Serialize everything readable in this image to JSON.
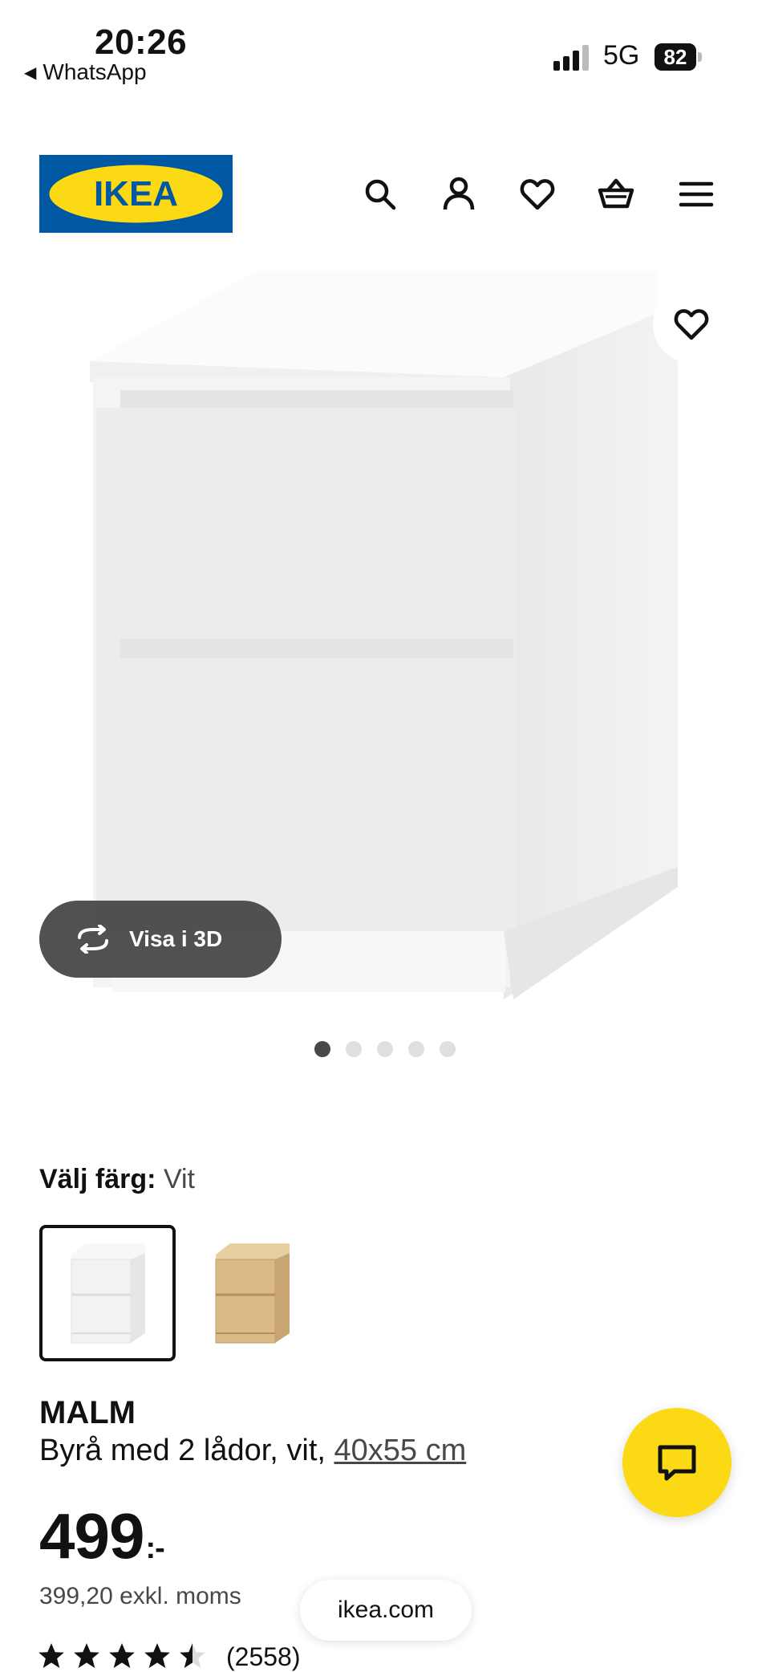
{
  "status_bar": {
    "time": "20:26",
    "back_app": "WhatsApp",
    "network": "5G",
    "battery": "82"
  },
  "header": {
    "logo_text": "IKEA",
    "icons": [
      "search-icon",
      "profile-icon",
      "heart-icon",
      "cart-icon",
      "menu-icon"
    ],
    "brand_colors": {
      "blue": "#0058a3",
      "yellow": "#fbd914"
    }
  },
  "gallery": {
    "view_3d_label": "Visa i 3D",
    "image_count": 5,
    "active_index": 0
  },
  "color_picker": {
    "label": "Välj färg:",
    "selected_value": "Vit",
    "options": [
      {
        "name": "white",
        "color": "#f2f2f2",
        "selected": true
      },
      {
        "name": "oak",
        "color": "#d9b985",
        "selected": false
      }
    ]
  },
  "product": {
    "name": "MALM",
    "description": "Byrå med 2 lådor, vit, ",
    "size_link": "40x55 cm",
    "price": "499",
    "currency_suffix": ":-",
    "price_excl_vat": "399,20 exkl. moms",
    "rating": 4.5,
    "review_count": "(2558)"
  },
  "browser": {
    "url": "ikea.com"
  }
}
